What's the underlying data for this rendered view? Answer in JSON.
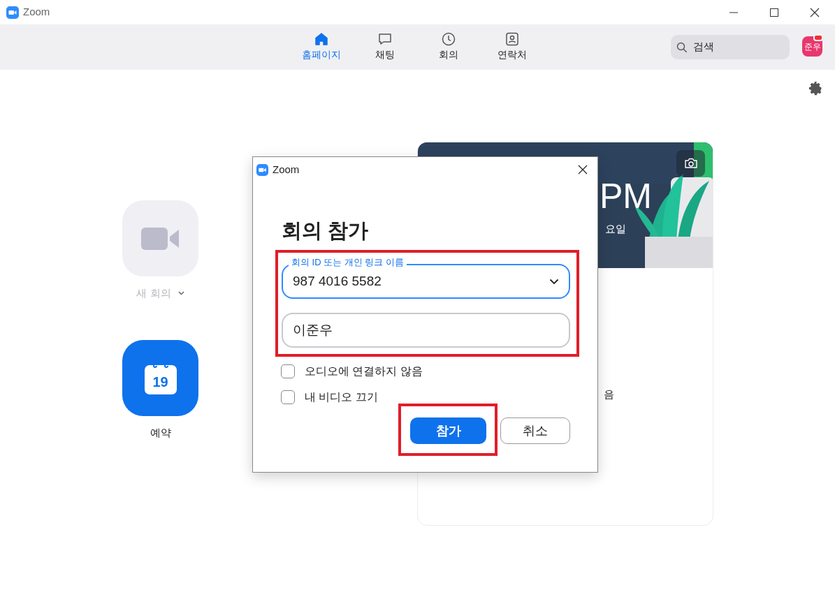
{
  "window": {
    "title": "Zoom"
  },
  "nav_tabs": [
    {
      "label": "홈페이지",
      "selected": true
    },
    {
      "label": "채팅",
      "selected": false
    },
    {
      "label": "회의",
      "selected": false
    },
    {
      "label": "연락처",
      "selected": false
    }
  ],
  "search": {
    "placeholder": "검색"
  },
  "avatar": {
    "initials": "준우"
  },
  "actions": [
    {
      "kind": "video",
      "label": "새 회의",
      "disabled": true
    },
    {
      "kind": "calendar",
      "label": "예약",
      "day": "19",
      "disabled": false
    }
  ],
  "card": {
    "time": "PM",
    "day": "요일",
    "note": "음"
  },
  "dialog": {
    "title": "Zoom",
    "heading": "회의 참가",
    "meeting_id": {
      "label": "회의 ID 또는 개인 링크 이름",
      "value": "987 4016 5582"
    },
    "name_field": {
      "value": "이준우"
    },
    "options": [
      {
        "label": "오디오에 연결하지 않음",
        "checked": false
      },
      {
        "label": "내 비디오 끄기",
        "checked": false
      }
    ],
    "buttons": [
      {
        "label": "참가",
        "kind": "primary"
      },
      {
        "label": "취소",
        "kind": "secondary"
      }
    ]
  }
}
